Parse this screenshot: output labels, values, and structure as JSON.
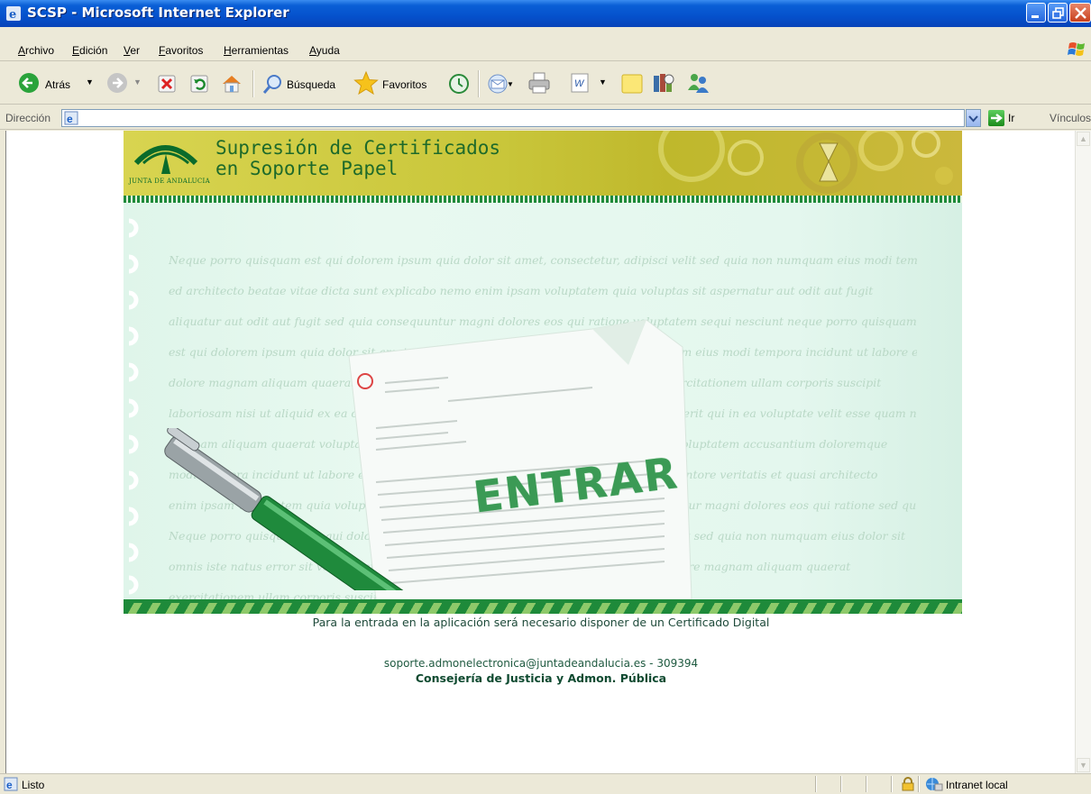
{
  "window": {
    "title": "SCSP - Microsoft Internet Explorer"
  },
  "menu": [
    "Archivo",
    "Edición",
    "Ver",
    "Favoritos",
    "Herramientas",
    "Ayuda"
  ],
  "toolbar": {
    "back_label": "Atrás",
    "search_label": "Búsqueda",
    "favorites_label": "Favoritos"
  },
  "addressbar": {
    "label": "Dirección",
    "value": "",
    "go_label": "Ir",
    "links_label": "Vínculos"
  },
  "page": {
    "logo_text": "JUNTA DE ANDALUCIA",
    "banner_title_line1": "Supresión de Certificados",
    "banner_title_line2": "en Soporte Papel",
    "entrar_label": "ENTRAR",
    "notice": "Para la entrada en la aplicación será necesario disponer de un Certificado Digital",
    "contact": "soporte.admonelectronica@juntadeandalucia.es - 309394",
    "department": "Consejería de Justicia y Admon. Pública"
  },
  "status": {
    "text": "Listo",
    "zone": "Intranet local"
  },
  "colors": {
    "titlebar": "#0551cc",
    "banner": "#c9c63a",
    "accent_green": "#1e8a3a"
  }
}
